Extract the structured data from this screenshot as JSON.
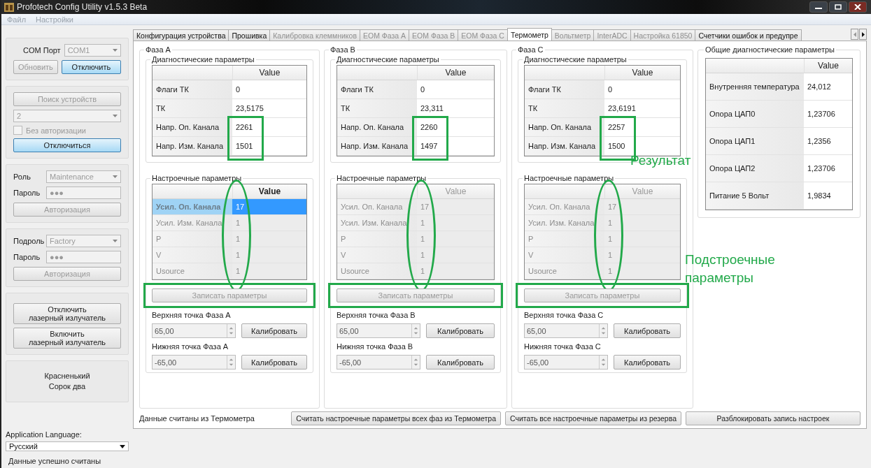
{
  "window": {
    "title": "Profotech Config Utility v1.5.3 Beta"
  },
  "menu": [
    {
      "label": "Файл",
      "disabled": true
    },
    {
      "label": "Настройки",
      "disabled": true
    }
  ],
  "sidebar": {
    "connection": {
      "label": "COM Порт",
      "port": "COM1",
      "port_disabled": true,
      "buttons": [
        {
          "label": "Обновить",
          "disabled": true,
          "highlighted": false
        },
        {
          "label": "Отключить",
          "disabled": false,
          "highlighted": true
        }
      ]
    },
    "device": {
      "search_button": {
        "label": "Поиск устройств",
        "disabled": true
      },
      "device_select": {
        "value": "2",
        "disabled": true
      },
      "no_auth": {
        "label": "Без авторизации",
        "checked": false,
        "disabled": true
      },
      "disconnect_button": {
        "label": "Отключиться",
        "highlighted": true
      }
    },
    "role": {
      "label": "Роль",
      "value": "Maintenance",
      "password_label": "Пароль",
      "password": "●●●",
      "auth_button": {
        "label": "Авторизация",
        "disabled": true
      }
    },
    "subrole": {
      "label": "Подроль",
      "value": "Factory",
      "password_label": "Пароль",
      "password": "●●●",
      "auth_button": {
        "label": "Авторизация",
        "disabled": true
      }
    },
    "laser_buttons": [
      {
        "label": "Отключить\nлазерный излучатель"
      },
      {
        "label": "Включить\nлазерный излучатель"
      }
    ],
    "device_name": "Красненький\nСорок два",
    "language": {
      "label": "Application Language:",
      "value": "Русский"
    }
  },
  "tabs": [
    {
      "label": "Конфигурация устройства",
      "selected": false,
      "disabled": false
    },
    {
      "label": "Прошивка",
      "selected": false,
      "disabled": false
    },
    {
      "label": "Калибровка клеммников",
      "selected": false,
      "disabled": true
    },
    {
      "label": "ЕОМ Фаза A",
      "selected": false,
      "disabled": true
    },
    {
      "label": "ЕОМ Фаза B",
      "selected": false,
      "disabled": true
    },
    {
      "label": "ЕОМ Фаза C",
      "selected": false,
      "disabled": true
    },
    {
      "label": "Термометр",
      "selected": true,
      "disabled": false
    },
    {
      "label": "Вольтметр",
      "selected": false,
      "disabled": true
    },
    {
      "label": "InterADC",
      "selected": false,
      "disabled": true
    },
    {
      "label": "Настройка 61850",
      "selected": false,
      "disabled": true
    },
    {
      "label": "Счетчики ошибок и предупре",
      "selected": false,
      "disabled": false
    }
  ],
  "phases": [
    {
      "title": "Фаза A",
      "diag_title": "Диагностические параметры",
      "diag_header": "Value",
      "diag_rows": [
        {
          "name": "Флаги ТК",
          "value": "0"
        },
        {
          "name": "ТК",
          "value": "23,5175"
        },
        {
          "name": "Напр. Оп. Канала",
          "value": "2261"
        },
        {
          "name": "Напр. Изм. Канала",
          "value": "1501"
        }
      ],
      "tuning_title": "Настроечные параметры",
      "tuning_header": "Value",
      "tuning_disabled": false,
      "tuning_rows": [
        {
          "name": "Усил. Оп. Канала",
          "value": "17",
          "selected": true
        },
        {
          "name": "Усил. Изм. Канала",
          "value": "1",
          "selected": false
        },
        {
          "name": "P",
          "value": "1",
          "selected": false
        },
        {
          "name": "V",
          "value": "1",
          "selected": false
        },
        {
          "name": "Usource",
          "value": "1",
          "selected": false
        }
      ],
      "write_button": {
        "label": "Записать параметры",
        "disabled": true
      },
      "upper": {
        "label": "Верхняя точка Фаза A",
        "value": "65,00",
        "button": "Калибровать"
      },
      "lower": {
        "label": "Нижняя точка Фаза A",
        "value": "-65,00",
        "button": "Калибровать"
      },
      "mark_results": true,
      "mark_tuning": true,
      "mark_write": true
    },
    {
      "title": "Фаза B",
      "diag_title": "Диагностические параметры",
      "diag_header": "Value",
      "diag_rows": [
        {
          "name": "Флаги ТК",
          "value": "0"
        },
        {
          "name": "ТК",
          "value": "23,311"
        },
        {
          "name": "Напр. Оп. Канала",
          "value": "2260"
        },
        {
          "name": "Напр. Изм. Канала",
          "value": "1497"
        }
      ],
      "tuning_title": "Настроечные параметры",
      "tuning_header": "Value",
      "tuning_disabled": true,
      "tuning_rows": [
        {
          "name": "Усил. Оп. Канала",
          "value": "17",
          "selected": false
        },
        {
          "name": "Усил. Изм. Канала",
          "value": "1",
          "selected": false
        },
        {
          "name": "P",
          "value": "1",
          "selected": false
        },
        {
          "name": "V",
          "value": "1",
          "selected": false
        },
        {
          "name": "Usource",
          "value": "1",
          "selected": false
        }
      ],
      "write_button": {
        "label": "Записать параметры",
        "disabled": true
      },
      "upper": {
        "label": "Верхняя точка Фаза B",
        "value": "65,00",
        "button": "Калибровать"
      },
      "lower": {
        "label": "Нижняя точка Фаза B",
        "value": "-65,00",
        "button": "Калибровать"
      },
      "mark_results": true,
      "mark_tuning": true,
      "mark_write": true
    },
    {
      "title": "Фаза C",
      "diag_title": "Диагностические параметры",
      "diag_header": "Value",
      "diag_rows": [
        {
          "name": "Флаги ТК",
          "value": "0"
        },
        {
          "name": "ТК",
          "value": "23,6191"
        },
        {
          "name": "Напр. Оп. Канала",
          "value": "2257"
        },
        {
          "name": "Напр. Изм. Канала",
          "value": "1500"
        }
      ],
      "tuning_title": "Настроечные параметры",
      "tuning_header": "Value",
      "tuning_disabled": true,
      "tuning_rows": [
        {
          "name": "Усил. Оп. Канала",
          "value": "17",
          "selected": false
        },
        {
          "name": "Усил. Изм. Канала",
          "value": "1",
          "selected": false
        },
        {
          "name": "P",
          "value": "1",
          "selected": false
        },
        {
          "name": "V",
          "value": "1",
          "selected": false
        },
        {
          "name": "Usource",
          "value": "1",
          "selected": false
        }
      ],
      "write_button": {
        "label": "Записать параметры",
        "disabled": true
      },
      "upper": {
        "label": "Верхняя точка Фаза C",
        "value": "65,00",
        "button": "Калибровать"
      },
      "lower": {
        "label": "Нижняя точка Фаза C",
        "value": "-65,00",
        "button": "Калибровать"
      },
      "mark_results": true,
      "mark_tuning": true,
      "mark_write": true
    }
  ],
  "general": {
    "title": "Общие диагностические параметры",
    "header": "Value",
    "rows": [
      {
        "name": "Внутренняя температура",
        "value": "24,012"
      },
      {
        "name": "Опора ЦАП0",
        "value": "1,23706"
      },
      {
        "name": "Опора ЦАП1",
        "value": "1,2356"
      },
      {
        "name": "Опора ЦАП2",
        "value": "1,23706"
      },
      {
        "name": "Питание 5 Вольт",
        "value": "1,9834"
      }
    ]
  },
  "footer": {
    "status": "Данные считаны из Термометра",
    "buttons": [
      {
        "label": "Считать настроечные параметры всех фаз из Термометра"
      },
      {
        "label": "Считать все настроечные параметры из резерва"
      },
      {
        "label": "Разблокировать запись настроек"
      }
    ]
  },
  "annotations": {
    "result_note": "Результат",
    "tuning_note": "Подстроечные\nпараметры"
  },
  "status_bar": "Данные успешно считаны"
}
